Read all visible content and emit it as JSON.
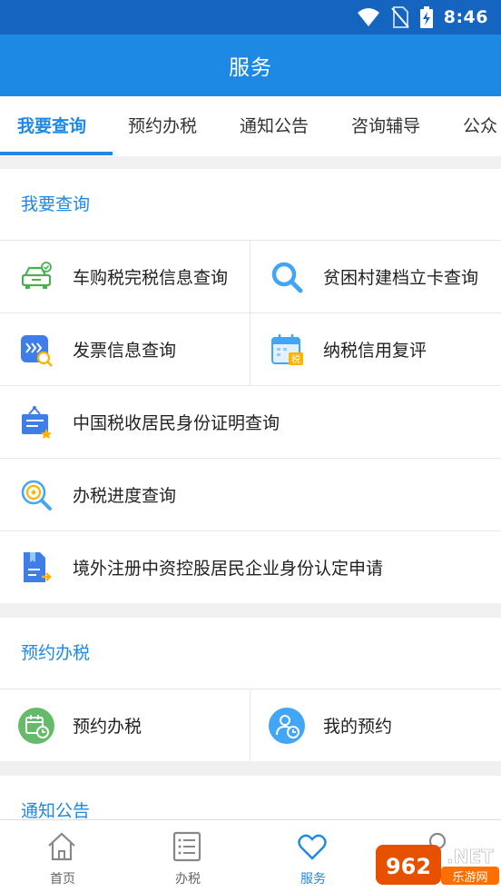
{
  "status_bar": {
    "time": "8:46"
  },
  "app_bar": {
    "title": "服务"
  },
  "tabs": [
    {
      "label": "我要查询",
      "active": true
    },
    {
      "label": "预约办税",
      "active": false
    },
    {
      "label": "通知公告",
      "active": false
    },
    {
      "label": "咨询辅导",
      "active": false
    },
    {
      "label": "公众",
      "active": false
    }
  ],
  "sections": {
    "query": {
      "title": "我要查询",
      "items": [
        {
          "label": "车购税完税信息查询",
          "icon": "car-icon"
        },
        {
          "label": "贫困村建档立卡查询",
          "icon": "magnifier-icon"
        },
        {
          "label": "发票信息查询",
          "icon": "invoice-search-icon"
        },
        {
          "label": "纳税信用复评",
          "icon": "calendar-tax-icon"
        },
        {
          "label": "中国税收居民身份证明查询",
          "icon": "certificate-icon"
        },
        {
          "label": "办税进度查询",
          "icon": "progress-search-icon"
        },
        {
          "label": "境外注册中资控股居民企业身份认定申请",
          "icon": "document-arrow-icon"
        }
      ]
    },
    "appointment": {
      "title": "预约办税",
      "items": [
        {
          "label": "预约办税",
          "icon": "calendar-clock-icon"
        },
        {
          "label": "我的预约",
          "icon": "user-clock-icon"
        }
      ]
    },
    "notice": {
      "title": "通知公告"
    }
  },
  "bottom_nav": [
    {
      "label": "首页",
      "icon": "home-icon",
      "active": false
    },
    {
      "label": "办税",
      "icon": "list-icon",
      "active": false
    },
    {
      "label": "服务",
      "icon": "heart-icon",
      "active": true
    },
    {
      "label": "",
      "icon": "user-icon",
      "active": false
    }
  ],
  "watermark": {
    "text": "962.NET",
    "subtext": "乐游网"
  },
  "colors": {
    "primary": "#1e88e5",
    "status_bar": "#1565c0",
    "green": "#4caf50",
    "orange": "#ffb300"
  }
}
